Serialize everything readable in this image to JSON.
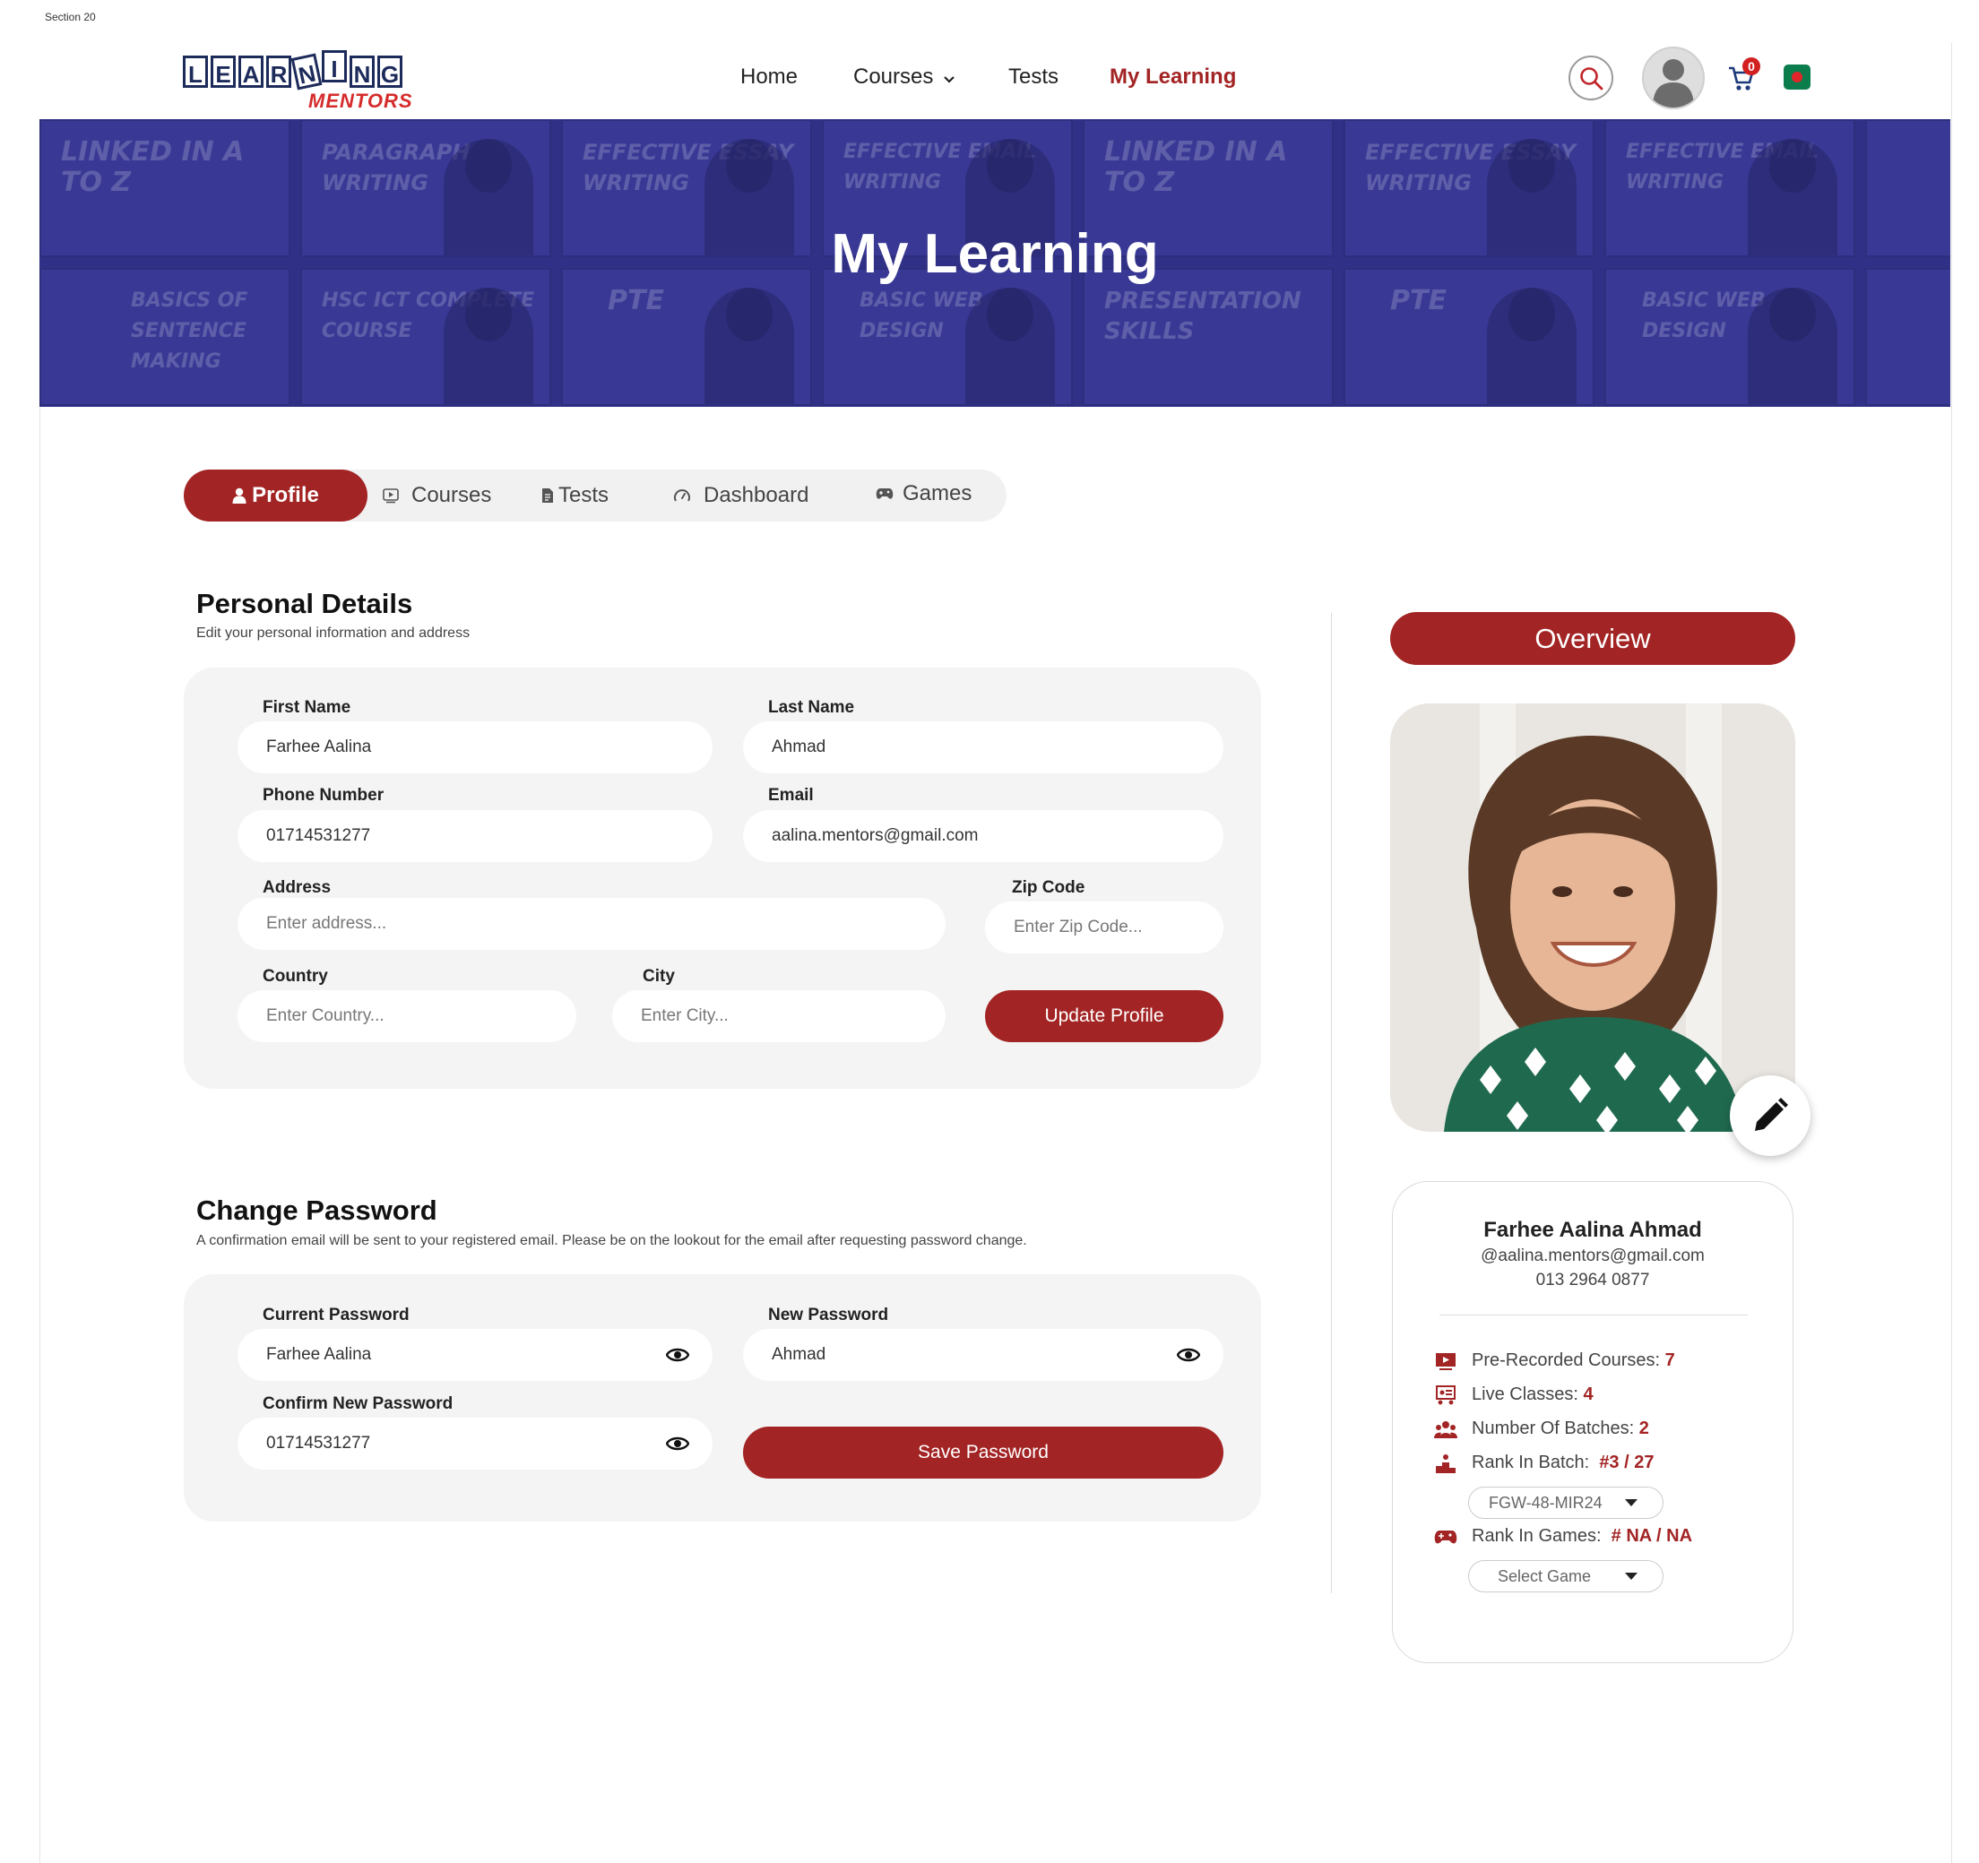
{
  "section_label": "Section 20",
  "logo": {
    "letters": [
      "L",
      "E",
      "A",
      "R",
      "N",
      "I",
      "N",
      "G"
    ],
    "sub": "MENTORS"
  },
  "nav": {
    "items": [
      {
        "label": "Home"
      },
      {
        "label": "Courses"
      },
      {
        "label": "Tests"
      },
      {
        "label": "My Learning"
      }
    ],
    "cart_count": "0"
  },
  "banner": {
    "title": "My Learning",
    "tiles": [
      "LINKED IN A TO Z",
      "PARAGRAPH WRITING",
      "EFFECTIVE ESSAY WRITING",
      "EFFECTIVE EMAIL WRITING",
      "LINKED IN A TO Z",
      "EFFECTIVE ESSAY WRITING",
      "EFFECTIVE EMAIL WRITING",
      "BASICS OF SENTENCE MAKING",
      "HSC ICT COMPLETE COURSE",
      "PTE",
      "BASIC WEB DESIGN",
      "PRESENTATION SKILLS",
      "PTE",
      "BASIC WEB DESIGN"
    ]
  },
  "tabs": [
    {
      "label": "Profile",
      "icon": "user-icon"
    },
    {
      "label": "Courses",
      "icon": "video-icon"
    },
    {
      "label": "Tests",
      "icon": "document-icon"
    },
    {
      "label": "Dashboard",
      "icon": "gauge-icon"
    },
    {
      "label": "Games",
      "icon": "gamepad-icon"
    }
  ],
  "personal": {
    "title": "Personal Details",
    "subtitle": "Edit your personal information and address",
    "first_name": {
      "label": "First Name",
      "value": "Farhee Aalina"
    },
    "last_name": {
      "label": "Last Name",
      "value": "Ahmad"
    },
    "phone": {
      "label": "Phone Number",
      "value": "01714531277"
    },
    "email": {
      "label": "Email",
      "value": "aalina.mentors@gmail.com"
    },
    "address": {
      "label": "Address",
      "placeholder": "Enter address..."
    },
    "zip": {
      "label": "Zip Code",
      "placeholder": "Enter Zip Code..."
    },
    "country": {
      "label": "Country",
      "placeholder": "Enter Country..."
    },
    "city": {
      "label": "City",
      "placeholder": "Enter City..."
    },
    "update_label": "Update Profile"
  },
  "password": {
    "title": "Change Password",
    "subtitle": "A confirmation email will be sent to your registered email. Please be on the lookout for the email after requesting password change.",
    "current": {
      "label": "Current Password",
      "value": "Farhee Aalina"
    },
    "new": {
      "label": "New Password",
      "value": "Ahmad"
    },
    "confirm": {
      "label": "Confirm New Password",
      "value": "01714531277"
    },
    "save_label": "Save Password"
  },
  "overview": {
    "title": "Overview",
    "name": "Farhee Aalina Ahmad",
    "email": "@aalina.mentors@gmail.com",
    "phone": "013 2964 0877",
    "stats": {
      "prerecorded": {
        "label": "Pre-Recorded Courses:",
        "value": "7"
      },
      "live": {
        "label": "Live Classes:",
        "value": "4"
      },
      "batches": {
        "label": "Number Of Batches:",
        "value": "2"
      },
      "rank_batch": {
        "label": "Rank In Batch:",
        "value": "#3 / 27"
      },
      "rank_games": {
        "label": "Rank In Games:",
        "value": "# NA / NA"
      }
    },
    "batch_select": "FGW-48-MIR24",
    "game_select": "Select Game"
  },
  "colors": {
    "accent": "#a32424",
    "banner": "#2a2f78"
  }
}
